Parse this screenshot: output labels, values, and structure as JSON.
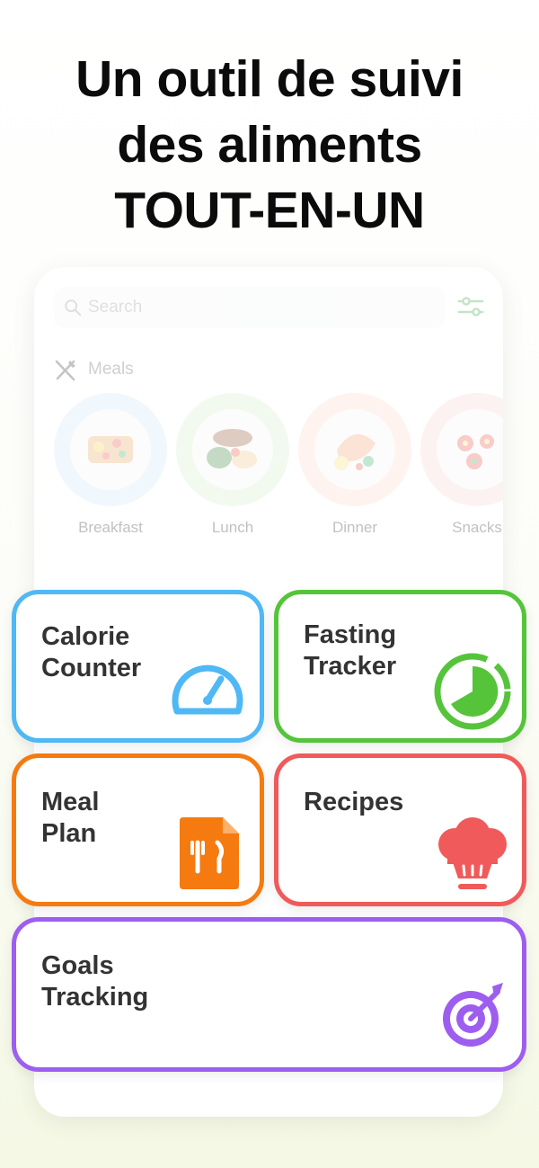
{
  "headline": {
    "line1": "Un outil de suivi",
    "line2": "des aliments",
    "line3": "TOUT-EN-UN"
  },
  "app": {
    "search": {
      "placeholder": "Search"
    },
    "meals_section": {
      "title": "Meals"
    },
    "meals": [
      {
        "label": "Breakfast",
        "ring_color": "#dbeefc"
      },
      {
        "label": "Lunch",
        "ring_color": "#dff3dc"
      },
      {
        "label": "Dinner",
        "ring_color": "#fde3d6"
      },
      {
        "label": "Snacks",
        "ring_color": "#fbdede"
      }
    ]
  },
  "features": [
    {
      "line1": "Calorie",
      "line2": "Counter",
      "color": "#4fb8f5",
      "icon": "speedometer-icon"
    },
    {
      "line1": "Fasting",
      "line2": "Tracker",
      "color": "#55c43a",
      "icon": "fasting-timer-icon"
    },
    {
      "line1": "Meal",
      "line2": "Plan",
      "color": "#f57a10",
      "icon": "meal-plan-document-icon"
    },
    {
      "line1": "Recipes",
      "line2": "",
      "color": "#f05a5a",
      "icon": "chef-hat-icon"
    },
    {
      "line1": "Goals",
      "line2": "Tracking",
      "color": "#9d5ef0",
      "icon": "target-icon"
    }
  ]
}
